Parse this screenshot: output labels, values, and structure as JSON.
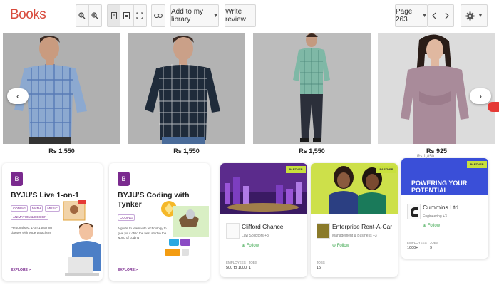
{
  "toolbar": {
    "brand": "Books",
    "add_to_library": "Add to my library",
    "write_review": "Write review",
    "page_indicator": "Page 263"
  },
  "icons": [
    "zoom-out-icon",
    "zoom-in-icon",
    "single-page-icon",
    "text-view-icon",
    "fullscreen-icon",
    "link-icon",
    "chevron-left-icon",
    "chevron-right-icon",
    "gear-icon"
  ],
  "products": [
    {
      "price": "Rs 1,550"
    },
    {
      "price": "Rs 1,550"
    },
    {
      "price": "Rs 1,550"
    },
    {
      "price": "Rs 925"
    }
  ],
  "cut_price": "Rs 1,850",
  "byju_cards": [
    {
      "logo": "B",
      "title": "BYJU'S Live 1-on-1",
      "tags": [
        "CODING",
        "MATH",
        "MUSIC",
        "ANIMATION & DESIGN"
      ],
      "description": "Personalised, 1-on-1 tutoring classes with expert teachers",
      "explore": "EXPLORE >"
    },
    {
      "logo": "B",
      "title": "BYJU'S Coding with Tynker",
      "tags": [
        "CODING"
      ],
      "description": "A guide to learn with technology to give your child the best start in the world of coding",
      "explore": "EXPLORE >"
    }
  ],
  "job_cards": [
    {
      "name": "Clifford Chance",
      "sub": "Law Solicitors +3",
      "follow": "Follow",
      "partner": "PARTNER",
      "labels": [
        "EMPLOYEES",
        "JOBS"
      ],
      "values": [
        "500 to 1000",
        "1"
      ]
    },
    {
      "name": "Enterprise Rent-A-Car",
      "sub": "Management & Business +3",
      "follow": "Follow",
      "partner": "PARTNER",
      "labels": [
        "JOBS"
      ],
      "values": [
        "15"
      ]
    },
    {
      "name": "Cummins Ltd",
      "sub": "Engineering +3",
      "follow": "Follow",
      "partner": "PARTNER",
      "banner_text": "POWERING YOUR POTENTIAL",
      "labels": [
        "EMPLOYEES",
        "JOBS"
      ],
      "values": [
        "1000+",
        "9"
      ]
    }
  ],
  "colors": {
    "brand": "#d84a3c",
    "byju": "#7a2a8e",
    "partner": "#c8e03c",
    "follow": "#3aa64c",
    "promo": "#e53935"
  }
}
